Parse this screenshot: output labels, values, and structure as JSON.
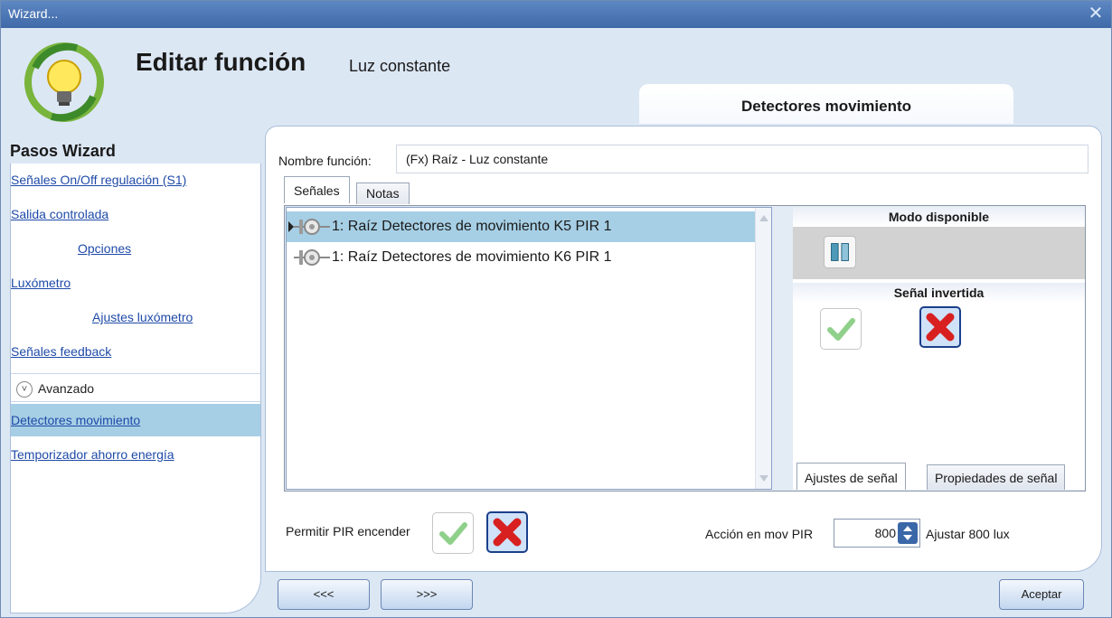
{
  "window": {
    "title": "Wizard..."
  },
  "header": {
    "title": "Editar función",
    "subtitle": "Luz constante",
    "tab": "Detectores movimiento"
  },
  "sidebar": {
    "heading": "Pasos Wizard",
    "items": [
      {
        "label": "Señales On/Off regulación (S1)"
      },
      {
        "label": "Salida controlada"
      },
      {
        "label": "Opciones"
      },
      {
        "label": "Luxómetro"
      },
      {
        "label": "Ajustes luxómetro"
      },
      {
        "label": "Señales feedback"
      },
      {
        "label": "Avanzado"
      },
      {
        "label": "Detectores movimiento"
      },
      {
        "label": "Temporizador ahorro energía"
      }
    ]
  },
  "form": {
    "name_label": "Nombre función:",
    "name_value": "(Fx) Raíz - Luz constante",
    "tabs": [
      "Señales",
      "Notas"
    ],
    "signals": [
      "1: Raíz Detectores de movimiento K5 PIR 1",
      "1: Raíz Detectores de movimiento K6 PIR 1"
    ],
    "props": {
      "mode_title": "Modo disponible",
      "inverted_title": "Señal invertida",
      "subtabs": [
        "Ajustes de señal",
        "Propiedades de señal"
      ]
    },
    "permit_label": "Permitir PIR encender",
    "action_label": "Acción en mov PIR",
    "action_value": "800",
    "lux_label": "Ajustar 800 lux"
  },
  "buttons": {
    "prev": "<<<",
    "next": ">>>",
    "accept": "Aceptar"
  },
  "colors": {
    "selected": "#a6cfe5",
    "titlebar": "#4a76b2",
    "link": "#1f4aa8"
  }
}
